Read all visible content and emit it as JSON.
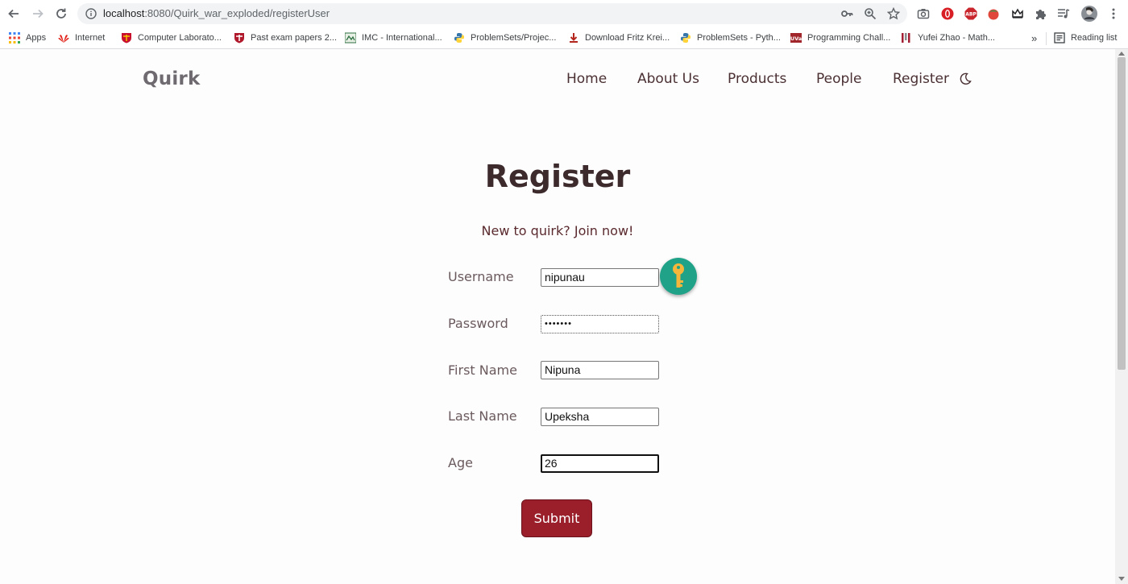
{
  "browser": {
    "url_host": "localhost",
    "url_path": ":8080/Quirk_war_exploded/registerUser",
    "reading_list_label": "Reading list",
    "bookmarks": [
      {
        "label": "Apps",
        "icon": "apps-grid-icon",
        "color": "#1a73e8"
      },
      {
        "label": "Internet",
        "icon": "huawei-icon",
        "color": "#e2231a"
      },
      {
        "label": "Computer Laborato...",
        "icon": "cambridge-crest-icon",
        "color": "#c8102e"
      },
      {
        "label": "Past exam papers 2...",
        "icon": "cambridge-crest-icon",
        "color": "#b0182c"
      },
      {
        "label": "IMC - International...",
        "icon": "imc-icon",
        "color": "#2b6e3f"
      },
      {
        "label": "ProblemSets/Projec...",
        "icon": "python-icon",
        "color": "#3776ab"
      },
      {
        "label": "Download Fritz Krei...",
        "icon": "download-icon",
        "color": "#b3261e"
      },
      {
        "label": "ProblemSets - Pyth...",
        "icon": "python-icon",
        "color": "#3776ab"
      },
      {
        "label": "Programming Chall...",
        "icon": "uva-icon",
        "color": "#a1262b"
      },
      {
        "label": "Yufei Zhao - Math...",
        "icon": "mit-icon",
        "color": "#a31f34"
      }
    ]
  },
  "site": {
    "brand": "Quirk",
    "nav": [
      "Home",
      "About Us",
      "Products",
      "People",
      "Register"
    ],
    "theme_toggle_icon": "moon-icon"
  },
  "form": {
    "title": "Register",
    "subtitle": "New to quirk? Join now!",
    "fields": [
      {
        "label": "Username",
        "value": "nipunau"
      },
      {
        "label": "Password",
        "value": "•••••••"
      },
      {
        "label": "First Name",
        "value": "Nipuna"
      },
      {
        "label": "Last Name",
        "value": "Upeksha"
      },
      {
        "label": "Age",
        "value": "26"
      }
    ],
    "submit_label": "Submit"
  },
  "colors": {
    "accent": "#9b1f2b",
    "heading": "#3d2a2d",
    "key_badge": "#1fa288"
  }
}
